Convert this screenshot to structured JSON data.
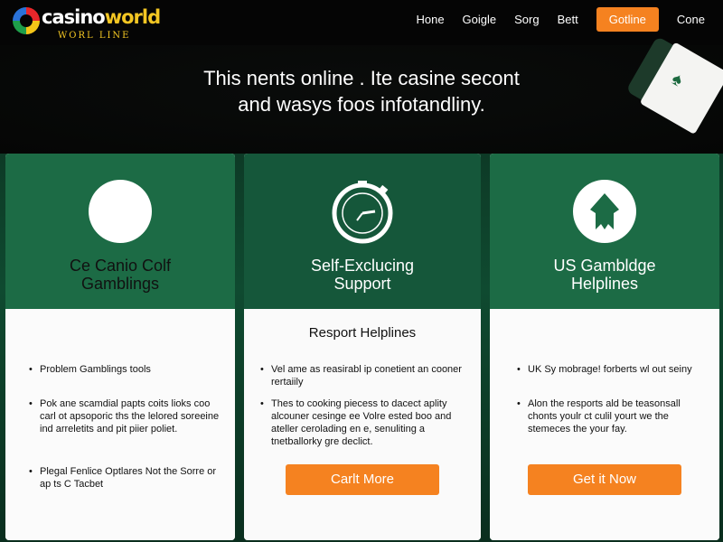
{
  "brand": {
    "name_main": "casino",
    "name_accent": "world",
    "tagline": "WORL LINE",
    "colors": {
      "accent": "#f58220",
      "green": "#1c6b45",
      "gold": "#f3c623"
    }
  },
  "nav": {
    "links": [
      "Hone",
      "Goigle",
      "Sorg",
      "Bett"
    ],
    "cta": "Gotline",
    "last": "Cone"
  },
  "hero": {
    "line1": "This nents online . Ite casine secont",
    "line2": "and wasys foos infotandliny."
  },
  "cards": [
    {
      "icon": "circle-icon",
      "title_line1": "Ce Canio Colf",
      "title_line2": "Gamblings",
      "bullets": [
        "Problem Gamblings tools",
        "Pok ane scamdial papts coits lioks coo carl ot apsoporic ths the lelored soreeine ind arreletits and pit piier poliet.",
        "Plegal Fenlice Optlares Not the Sorre or ap ts C Tacbet"
      ]
    },
    {
      "icon": "clock-icon",
      "title_line1": "Self-Exclucing",
      "title_line2": "Support",
      "subheading": "Resport Helplines",
      "bullets": [
        "Vel ame as reasirabl ip conetient an cooner rertaiily",
        "Thes to cooking piecess to dacect aplity alcouner cesinge ee Volre ested boo and ateller cerolading en e, senuliting a tnetballorky gre declict."
      ],
      "cta": "Carlt More"
    },
    {
      "icon": "shield-icon",
      "title_line1": "US Gambldge",
      "title_line2": "Helplines",
      "bullets": [
        "UK Sy mobrage! forberts wl out seiny",
        "Alon the resports ald be teasonsall chonts youlr ct culil yourt we the stemeces the your fay."
      ],
      "cta": "Get it Now"
    }
  ]
}
